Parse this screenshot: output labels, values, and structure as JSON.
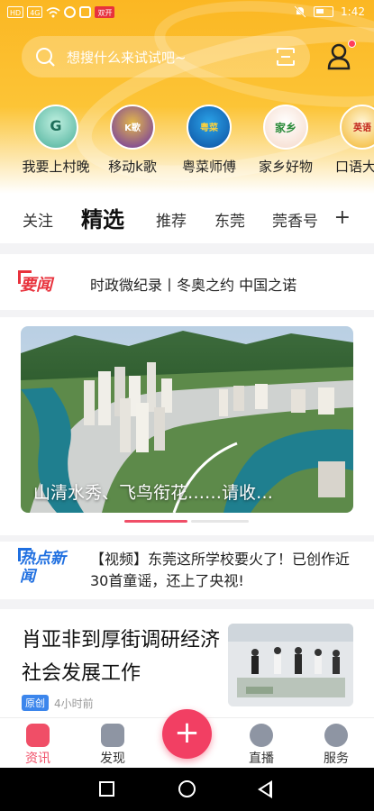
{
  "status_bar": {
    "time": "1:42",
    "left_chips": [
      "HD",
      "4G"
    ],
    "red_chip": "双开"
  },
  "search": {
    "placeholder": "想搜什么来试试吧~"
  },
  "channels": [
    {
      "label": "我要上村晚",
      "icon": "village-gala-logo",
      "color": "#4caf9a"
    },
    {
      "label": "移动k歌",
      "icon": "karaoke-logo",
      "color": "#7b3fbf"
    },
    {
      "label": "粤菜师傅",
      "icon": "cantonese-chef-logo",
      "color": "#1f7fd6"
    },
    {
      "label": "家乡好物",
      "icon": "hometown-goods-logo",
      "color": "#e94a3c"
    },
    {
      "label": "口语大赛",
      "icon": "oral-english-logo",
      "color": "#f0a81d"
    }
  ],
  "tabs": [
    "关注",
    "精选",
    "推荐",
    "东莞",
    "莞香号"
  ],
  "tabs_active": "精选",
  "tabs_plus": "+",
  "ticker": {
    "tag": "要闻",
    "text": "时政微纪录丨冬奥之约 中国之诺"
  },
  "banner": {
    "caption": "山清水秀、飞鸟衔花……请收…",
    "scene": "aerial-city-river-mountains"
  },
  "hot": {
    "tag": "热点新闻",
    "text": "【视频】东莞这所学校要火了！已创作近30首童谣，还上了央视!"
  },
  "article": {
    "title": "肖亚非到厚街调研经济社会发展工作",
    "badge": "原创",
    "time": "4小时前"
  },
  "bottom_nav": [
    {
      "label": "资讯",
      "icon": "news-icon",
      "active": true
    },
    {
      "label": "发现",
      "icon": "discover-icon",
      "active": false
    },
    {
      "label": "",
      "icon": "plus-icon",
      "active": false
    },
    {
      "label": "直播",
      "icon": "live-icon",
      "active": false
    },
    {
      "label": "服务",
      "icon": "service-icon",
      "active": false
    }
  ],
  "colors": {
    "accent": "#f04e67",
    "header": "#fbb723",
    "hot_blue": "#1f6fe0",
    "news_red": "#e8323c"
  }
}
